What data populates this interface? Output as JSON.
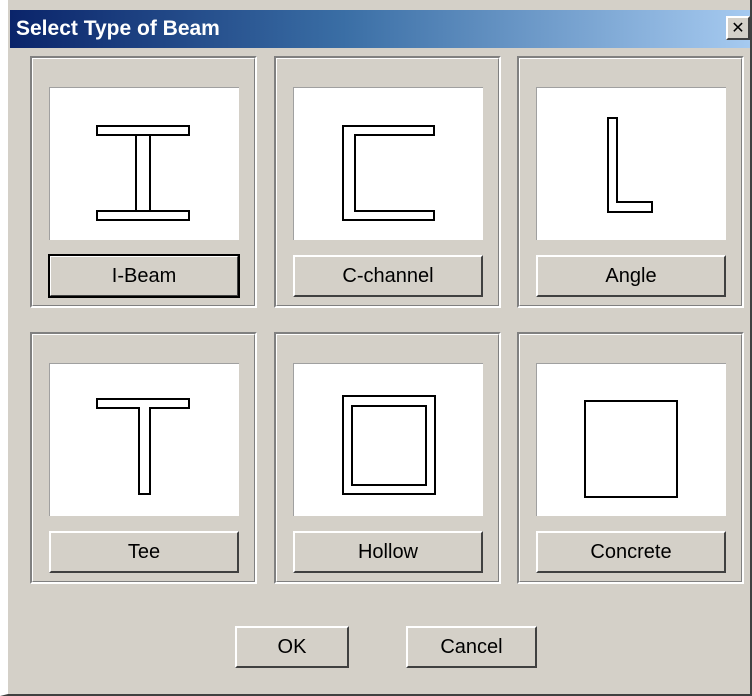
{
  "window": {
    "title": "Select Type of Beam",
    "close_glyph": "✕"
  },
  "beams": [
    {
      "label": "I-Beam",
      "icon": "i-beam-icon",
      "default": true
    },
    {
      "label": "C-channel",
      "icon": "c-channel-icon",
      "default": false
    },
    {
      "label": "Angle",
      "icon": "angle-icon",
      "default": false
    },
    {
      "label": "Tee",
      "icon": "tee-icon",
      "default": false
    },
    {
      "label": "Hollow",
      "icon": "hollow-icon",
      "default": false
    },
    {
      "label": "Concrete",
      "icon": "concrete-icon",
      "default": false
    }
  ],
  "footer": {
    "ok_label": "OK",
    "cancel_label": "Cancel"
  },
  "colors": {
    "face": "#d4d0c8",
    "title_start": "#0a246a",
    "title_end": "#a6caf0"
  }
}
